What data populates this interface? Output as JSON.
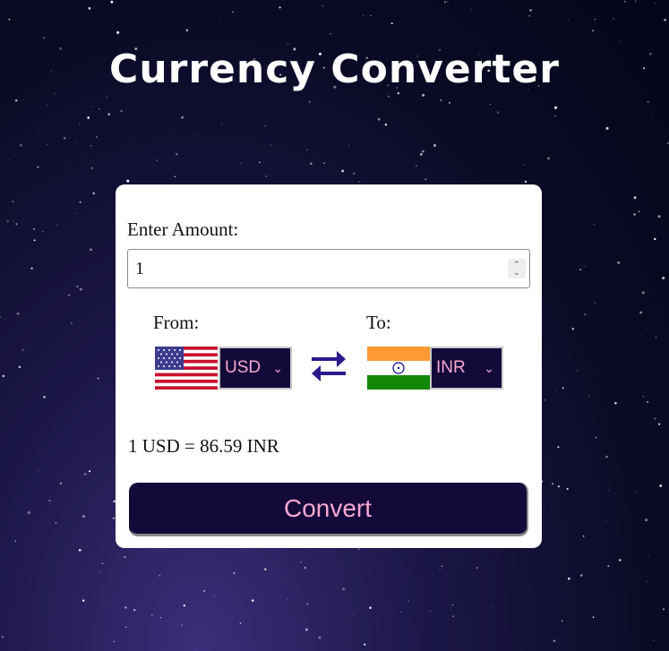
{
  "app": {
    "title": "Currency Converter"
  },
  "form": {
    "amount_label": "Enter Amount:",
    "amount_value": "1",
    "from_label": "From:",
    "to_label": "To:",
    "from_currency": "USD",
    "to_currency": "INR",
    "from_flag_icon": "us-flag-icon",
    "to_flag_icon": "india-flag-icon",
    "swap_icon": "swap-arrows-icon",
    "result_text": "1 USD = 86.59 INR",
    "convert_label": "Convert"
  },
  "colors": {
    "button_bg": "#140a3a",
    "button_text": "#f7a8d0",
    "card_bg": "#ffffff",
    "swap_arrow": "#2a1a8c"
  }
}
